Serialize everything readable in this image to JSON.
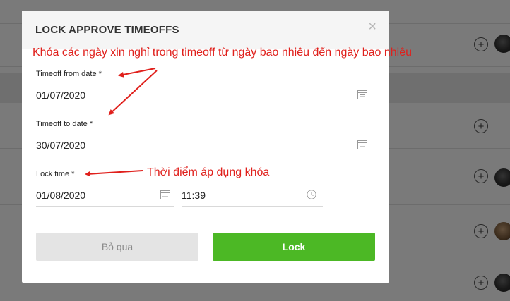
{
  "dialog": {
    "title": "LOCK APPROVE TIMEOFFS",
    "close_symbol": "×"
  },
  "form": {
    "from_date": {
      "label": "Timeoff from date *",
      "value": "01/07/2020"
    },
    "to_date": {
      "label": "Timeoff to date *",
      "value": "30/07/2020"
    },
    "lock_time": {
      "label": "Lock time *",
      "date": "01/08/2020",
      "time": "11:39"
    }
  },
  "buttons": {
    "cancel": "Bỏ qua",
    "lock": "Lock"
  },
  "annotations": {
    "top": "Khóa các ngày xin nghỉ trong timeoff từ ngày bao nhiêu đến ngày bao nhiêu",
    "lock_time": "Thời điểm áp dụng khóa"
  },
  "background": {
    "plus_symbol": "+"
  },
  "colors": {
    "primary_button": "#4cb825",
    "annotation": "#e0201c",
    "overlay": "rgba(0,0,0,0.52)"
  }
}
